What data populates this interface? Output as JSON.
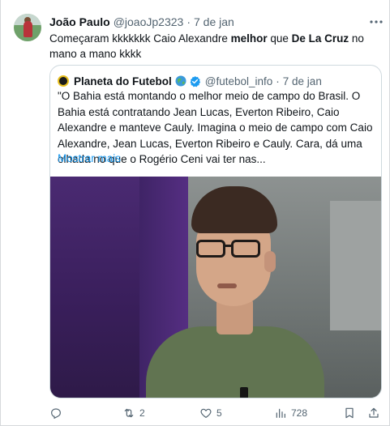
{
  "tweet": {
    "author_name": "João Paulo",
    "author_handle": "@joaoJp2323",
    "separator": "·",
    "date": "7 de jan",
    "text_parts": {
      "p1": "Começaram kkkkkkk Caio Alexandre ",
      "b1": "melhor",
      "p2": " que ",
      "b2": "De La Cruz",
      "p3": " no mano a mano kkkk"
    }
  },
  "quote": {
    "author_name": "Planeta do Futebol",
    "author_handle": "@futebol_info",
    "separator": "·",
    "date": "7 de jan",
    "text": "\"O Bahia está montando o melhor meio de campo do Brasil. O Bahia está contratando Jean Lucas, Everton Ribeiro, Caio Alexandre e manteve Cauly. Imagina o meio de campo com Caio Alexandre, Jean Lucas, Everton Ribeiro e Cauly. Cara, dá uma olhada no que o Rogério Ceni vai ter nas...",
    "show_more": "Mostrar mais",
    "media_icon": "video-frame-man-with-glasses"
  },
  "actions": {
    "reply_count": "",
    "retweet_count": "2",
    "like_count": "5",
    "views_count": "728"
  },
  "icons": {
    "more": "more-icon",
    "globe": "globe-icon",
    "verified": "verified-badge-icon",
    "reply": "reply-icon",
    "retweet": "retweet-icon",
    "like": "heart-icon",
    "views": "views-icon",
    "bookmark": "bookmark-icon",
    "share": "share-icon"
  },
  "colors": {
    "link": "#1d9bf0",
    "secondary_text": "#536471",
    "border": "#cfd9de"
  }
}
